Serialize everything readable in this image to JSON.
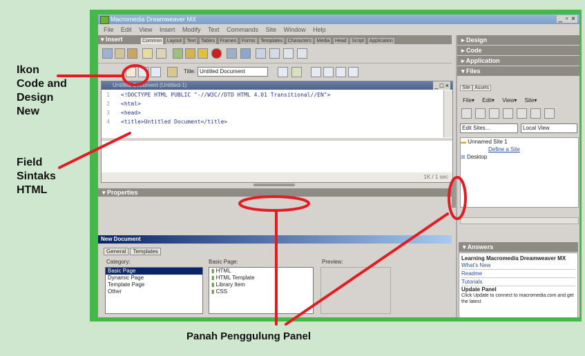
{
  "annotations": {
    "left_top_lines": [
      "Ikon",
      "Code and",
      "Design",
      "New"
    ],
    "left_mid_lines": [
      "Field",
      "Sintaks",
      "HTML"
    ],
    "bottom": "Panah Penggulung Panel"
  },
  "window": {
    "title": "Macromedia Dreamweaver MX",
    "controls": "_ ▫ ×"
  },
  "menu": [
    "File",
    "Edit",
    "View",
    "Insert",
    "Modify",
    "Text",
    "Commands",
    "Site",
    "Window",
    "Help"
  ],
  "insert_panel": {
    "label": "▾ Insert",
    "tabs": [
      "Common",
      "Layout",
      "Text",
      "Tables",
      "Frames",
      "Forms",
      "Templates",
      "Characters",
      "Media",
      "Head",
      "Script",
      "Application"
    ],
    "active_tab": 0
  },
  "doc_toolbar": {
    "title_label": "Title:",
    "title_value": "Untitled Document"
  },
  "document": {
    "window_title": "Untitled Document (Untitled-1)",
    "controls": "_ □ ×",
    "lines": [
      {
        "n": "1",
        "text": "<!DOCTYPE HTML PUBLIC \"-//W3C//DTD HTML 4.01 Transitional//EN\">"
      },
      {
        "n": "2",
        "text": "<html>"
      },
      {
        "n": "3",
        "text": "<head>"
      },
      {
        "n": "4",
        "text": "<title>Untitled Document</title>"
      }
    ],
    "status": "1K / 1 sec"
  },
  "properties_label": "▾ Properties",
  "new_document": {
    "header": "New Document",
    "tabs": [
      "General",
      "Templates"
    ],
    "category_label": "Category:",
    "categories": [
      "Basic Page",
      "Dynamic Page",
      "Template Page",
      "Other"
    ],
    "selected_category": 0,
    "basic_label": "Basic Page:",
    "basic_pages": [
      "HTML",
      "HTML Template",
      "Library Item",
      "CSS"
    ],
    "preview_label": "Preview:"
  },
  "right_panels": {
    "headers": [
      "▸ Design",
      "▸ Code",
      "▸ Application",
      "▾ Files"
    ],
    "file_tabs": [
      "Site",
      "Assets"
    ],
    "file_menu": [
      "File▾",
      "Edit▾",
      "View▾",
      "Site▾"
    ],
    "site_select": "Edit Sites...",
    "view_select": "Local View",
    "tree": [
      "Unnamed Site 1",
      "Define a Site",
      "Desktop"
    ],
    "answers_header": "▾ Answers",
    "answers_title": "Learning Macromedia Dreamweaver MX",
    "answers_links": [
      "What's New",
      "Readme",
      "Tutorials"
    ],
    "update_title": "Update Panel",
    "update_text": "Click Update to connect to macromedia.com and get the latest"
  },
  "colors": {
    "frame_green": "#44b94a",
    "background": "#cfe7cf",
    "annotation_red": "#e31b23"
  }
}
